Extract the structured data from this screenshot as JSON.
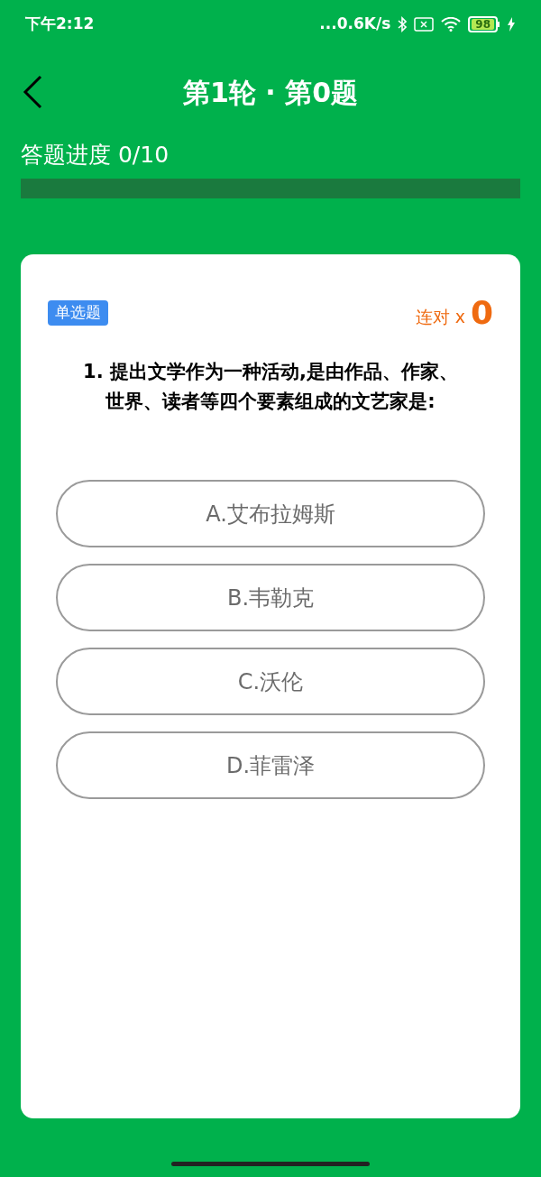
{
  "status_bar": {
    "time": "下午2:12",
    "network_speed": "...0.6K/s",
    "battery": "98"
  },
  "header": {
    "title": "第1轮 · 第0题"
  },
  "progress": {
    "label": "答题进度 0/10",
    "level": 0
  },
  "question": {
    "type_tag": "单选题",
    "streak_label": "连对 x",
    "streak_count": "0",
    "text": "1. 提出文学作为一种活动,是由作品、作家、世界、读者等四个要素组成的文艺家是:",
    "options": [
      {
        "label": "A.艾布拉姆斯",
        "selected": false
      },
      {
        "label": "B.韦勒克",
        "selected": false
      },
      {
        "label": "C.沃伦",
        "selected": false
      },
      {
        "label": "D.菲雷泽",
        "selected": false
      }
    ]
  }
}
